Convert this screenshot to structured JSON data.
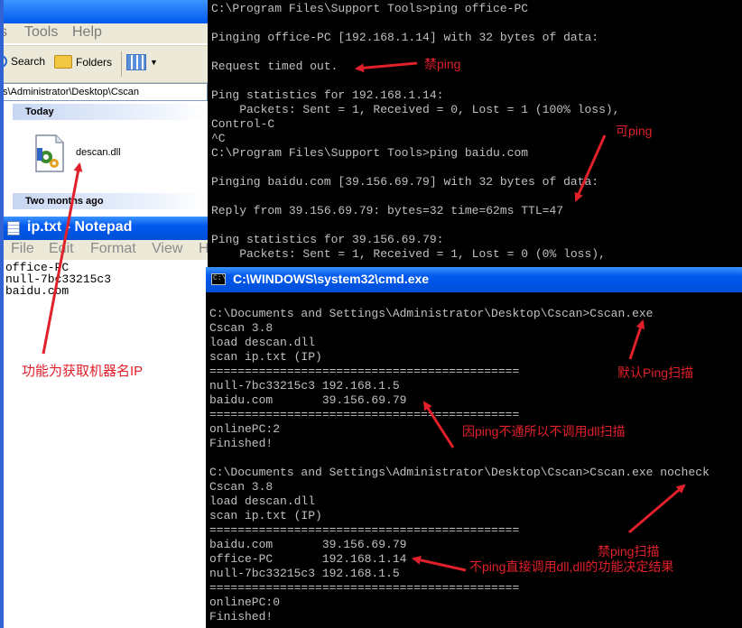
{
  "explorer": {
    "menu": [
      "s",
      "Tools",
      "Help"
    ],
    "toolbar": {
      "search_label": "Search",
      "folders_label": "Folders"
    },
    "address": "s\\Administrator\\Desktop\\Cscan",
    "groups": [
      "Today",
      "Two months ago"
    ],
    "file": {
      "name": "descan.dll"
    }
  },
  "notepad": {
    "title": "ip.txt - Notepad",
    "menu": [
      "File",
      "Edit",
      "Format",
      "View",
      "H"
    ],
    "lines": [
      "office-PC",
      "null-7bc33215c3",
      "baidu.com"
    ]
  },
  "console1": {
    "lines": [
      "C:\\Program Files\\Support Tools>ping office-PC",
      "",
      "Pinging office-PC [192.168.1.14] with 32 bytes of data:",
      "",
      "Request timed out.",
      "",
      "Ping statistics for 192.168.1.14:",
      "    Packets: Sent = 1, Received = 0, Lost = 1 (100% loss),",
      "Control-C",
      "^C",
      "C:\\Program Files\\Support Tools>ping baidu.com",
      "",
      "Pinging baidu.com [39.156.69.79] with 32 bytes of data:",
      "",
      "Reply from 39.156.69.79: bytes=32 time=62ms TTL=47",
      "",
      "Ping statistics for 39.156.69.79:",
      "    Packets: Sent = 1, Received = 1, Lost = 0 (0% loss),"
    ]
  },
  "cmd": {
    "title": "C:\\WINDOWS\\system32\\cmd.exe",
    "lines": [
      "",
      "C:\\Documents and Settings\\Administrator\\Desktop\\Cscan>Cscan.exe",
      "Cscan 3.8",
      "load descan.dll",
      "scan ip.txt (IP)",
      "============================================",
      "null-7bc33215c3 192.168.1.5",
      "baidu.com       39.156.69.79",
      "============================================",
      "onlinePC:2",
      "Finished!",
      "",
      "C:\\Documents and Settings\\Administrator\\Desktop\\Cscan>Cscan.exe nocheck",
      "Cscan 3.8",
      "load descan.dll",
      "scan ip.txt (IP)",
      "============================================",
      "baidu.com       39.156.69.79",
      "office-PC       192.168.1.14",
      "null-7bc33215c3 192.168.1.5",
      "============================================",
      "onlinePC:0",
      "Finished!"
    ]
  },
  "annotations": {
    "no_ping": "禁ping",
    "can_ping": "可ping",
    "get_hostname": "功能为获取机器名IP",
    "default_ping_scan": "默认Ping扫描",
    "no_dll_scan": "因ping不通所以不调用dll扫描",
    "no_ping_scan": "禁ping扫描",
    "direct_dll": "不ping直接调用dll,dll的功能决定结果"
  },
  "colors": {
    "annotation": "#e0202a",
    "console_text": "#c0c0c0",
    "xp_title_blue": "#0058ee"
  }
}
